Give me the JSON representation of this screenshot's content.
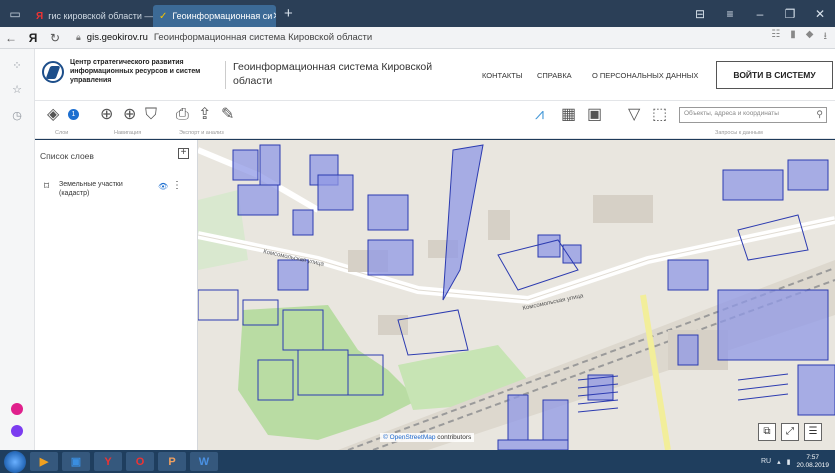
{
  "browser": {
    "tabs": [
      {
        "label": "гис кировской области —",
        "favicon": "yandex-icon",
        "active": false
      },
      {
        "label": "Геоинформационная си",
        "favicon": "geo-icon",
        "active": true
      }
    ],
    "url_domain": "gis.geokirov.ru",
    "page_title": "Геоинформационная система Кировской области",
    "yandex_letter": "Я"
  },
  "header": {
    "org_name": "Центр стратегического развития информационных ресурсов и систем управления",
    "system_title": "Геоинформационная система Кировской области",
    "menu": [
      "КОНТАКТЫ",
      "СПРАВКА",
      "О ПЕРСОНАЛЬНЫХ ДАННЫХ"
    ],
    "login_label": "ВОЙТИ В СИСТЕМУ"
  },
  "toolbar": {
    "layers_badge": "1",
    "groups": [
      "Слои",
      "Навигация",
      "Экспорт и анализ",
      "Запросы к данным"
    ],
    "search_placeholder": "Объекты, адреса и координаты"
  },
  "layers_panel": {
    "title": "Список слоев",
    "items": [
      {
        "label": "Земельные участки (кадастр)"
      }
    ]
  },
  "map": {
    "street_label": "Комсомольская улица",
    "attribution_link": "© OpenStreetMap",
    "attribution_rest": " contributors",
    "parcel_color": "#8f98e6",
    "parcel_stroke": "#2c3bb0"
  },
  "taskbar": {
    "lang": "RU",
    "time": "7:57",
    "date": "20.08.2019"
  }
}
